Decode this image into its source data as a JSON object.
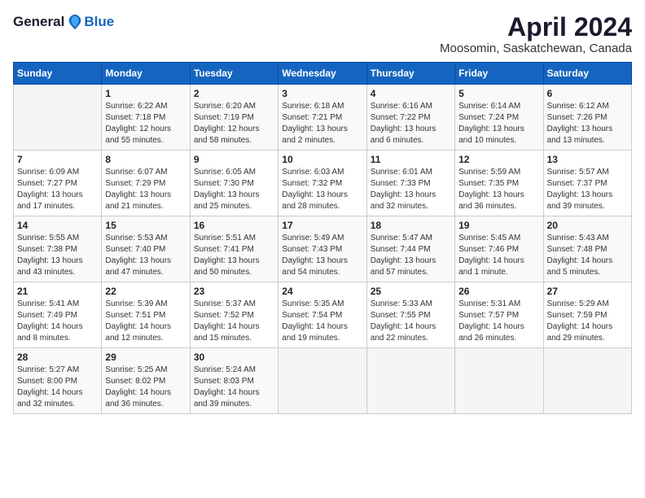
{
  "header": {
    "logo_general": "General",
    "logo_blue": "Blue",
    "title": "April 2024",
    "subtitle": "Moosomin, Saskatchewan, Canada"
  },
  "columns": [
    "Sunday",
    "Monday",
    "Tuesday",
    "Wednesday",
    "Thursday",
    "Friday",
    "Saturday"
  ],
  "weeks": [
    [
      {
        "day": "",
        "info": ""
      },
      {
        "day": "1",
        "info": "Sunrise: 6:22 AM\nSunset: 7:18 PM\nDaylight: 12 hours\nand 55 minutes."
      },
      {
        "day": "2",
        "info": "Sunrise: 6:20 AM\nSunset: 7:19 PM\nDaylight: 12 hours\nand 58 minutes."
      },
      {
        "day": "3",
        "info": "Sunrise: 6:18 AM\nSunset: 7:21 PM\nDaylight: 13 hours\nand 2 minutes."
      },
      {
        "day": "4",
        "info": "Sunrise: 6:16 AM\nSunset: 7:22 PM\nDaylight: 13 hours\nand 6 minutes."
      },
      {
        "day": "5",
        "info": "Sunrise: 6:14 AM\nSunset: 7:24 PM\nDaylight: 13 hours\nand 10 minutes."
      },
      {
        "day": "6",
        "info": "Sunrise: 6:12 AM\nSunset: 7:26 PM\nDaylight: 13 hours\nand 13 minutes."
      }
    ],
    [
      {
        "day": "7",
        "info": "Sunrise: 6:09 AM\nSunset: 7:27 PM\nDaylight: 13 hours\nand 17 minutes."
      },
      {
        "day": "8",
        "info": "Sunrise: 6:07 AM\nSunset: 7:29 PM\nDaylight: 13 hours\nand 21 minutes."
      },
      {
        "day": "9",
        "info": "Sunrise: 6:05 AM\nSunset: 7:30 PM\nDaylight: 13 hours\nand 25 minutes."
      },
      {
        "day": "10",
        "info": "Sunrise: 6:03 AM\nSunset: 7:32 PM\nDaylight: 13 hours\nand 28 minutes."
      },
      {
        "day": "11",
        "info": "Sunrise: 6:01 AM\nSunset: 7:33 PM\nDaylight: 13 hours\nand 32 minutes."
      },
      {
        "day": "12",
        "info": "Sunrise: 5:59 AM\nSunset: 7:35 PM\nDaylight: 13 hours\nand 36 minutes."
      },
      {
        "day": "13",
        "info": "Sunrise: 5:57 AM\nSunset: 7:37 PM\nDaylight: 13 hours\nand 39 minutes."
      }
    ],
    [
      {
        "day": "14",
        "info": "Sunrise: 5:55 AM\nSunset: 7:38 PM\nDaylight: 13 hours\nand 43 minutes."
      },
      {
        "day": "15",
        "info": "Sunrise: 5:53 AM\nSunset: 7:40 PM\nDaylight: 13 hours\nand 47 minutes."
      },
      {
        "day": "16",
        "info": "Sunrise: 5:51 AM\nSunset: 7:41 PM\nDaylight: 13 hours\nand 50 minutes."
      },
      {
        "day": "17",
        "info": "Sunrise: 5:49 AM\nSunset: 7:43 PM\nDaylight: 13 hours\nand 54 minutes."
      },
      {
        "day": "18",
        "info": "Sunrise: 5:47 AM\nSunset: 7:44 PM\nDaylight: 13 hours\nand 57 minutes."
      },
      {
        "day": "19",
        "info": "Sunrise: 5:45 AM\nSunset: 7:46 PM\nDaylight: 14 hours\nand 1 minute."
      },
      {
        "day": "20",
        "info": "Sunrise: 5:43 AM\nSunset: 7:48 PM\nDaylight: 14 hours\nand 5 minutes."
      }
    ],
    [
      {
        "day": "21",
        "info": "Sunrise: 5:41 AM\nSunset: 7:49 PM\nDaylight: 14 hours\nand 8 minutes."
      },
      {
        "day": "22",
        "info": "Sunrise: 5:39 AM\nSunset: 7:51 PM\nDaylight: 14 hours\nand 12 minutes."
      },
      {
        "day": "23",
        "info": "Sunrise: 5:37 AM\nSunset: 7:52 PM\nDaylight: 14 hours\nand 15 minutes."
      },
      {
        "day": "24",
        "info": "Sunrise: 5:35 AM\nSunset: 7:54 PM\nDaylight: 14 hours\nand 19 minutes."
      },
      {
        "day": "25",
        "info": "Sunrise: 5:33 AM\nSunset: 7:55 PM\nDaylight: 14 hours\nand 22 minutes."
      },
      {
        "day": "26",
        "info": "Sunrise: 5:31 AM\nSunset: 7:57 PM\nDaylight: 14 hours\nand 26 minutes."
      },
      {
        "day": "27",
        "info": "Sunrise: 5:29 AM\nSunset: 7:59 PM\nDaylight: 14 hours\nand 29 minutes."
      }
    ],
    [
      {
        "day": "28",
        "info": "Sunrise: 5:27 AM\nSunset: 8:00 PM\nDaylight: 14 hours\nand 32 minutes."
      },
      {
        "day": "29",
        "info": "Sunrise: 5:25 AM\nSunset: 8:02 PM\nDaylight: 14 hours\nand 36 minutes."
      },
      {
        "day": "30",
        "info": "Sunrise: 5:24 AM\nSunset: 8:03 PM\nDaylight: 14 hours\nand 39 minutes."
      },
      {
        "day": "",
        "info": ""
      },
      {
        "day": "",
        "info": ""
      },
      {
        "day": "",
        "info": ""
      },
      {
        "day": "",
        "info": ""
      }
    ]
  ]
}
